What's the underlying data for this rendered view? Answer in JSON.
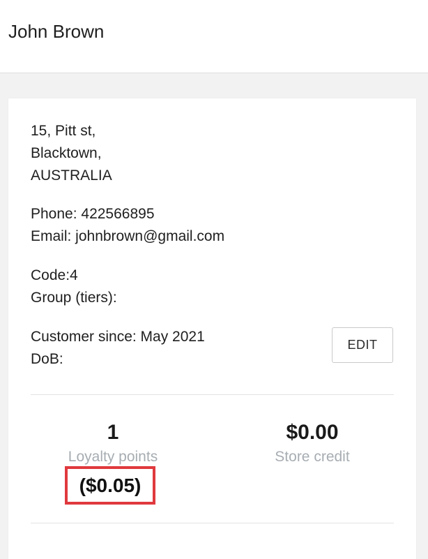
{
  "header": {
    "title": "John Brown"
  },
  "customer": {
    "address_lines": [
      "15, Pitt st,",
      "Blacktown,",
      "AUSTRALIA"
    ],
    "phone": "Phone: 422566895",
    "email": "Email: johnbrown@gmail.com",
    "code": "Code:4",
    "group": "Group (tiers):",
    "customer_since": "Customer since: May 2021",
    "dob": "DoB:"
  },
  "actions": {
    "edit_label": "EDIT"
  },
  "stats": {
    "loyalty_points_value": "1",
    "loyalty_points_label": "Loyalty points",
    "loyalty_points_money": "($0.05)",
    "store_credit_value": "$0.00",
    "store_credit_label": "Store credit"
  },
  "colors": {
    "highlight_border": "#e0393e",
    "muted_label": "#a7adb2"
  }
}
